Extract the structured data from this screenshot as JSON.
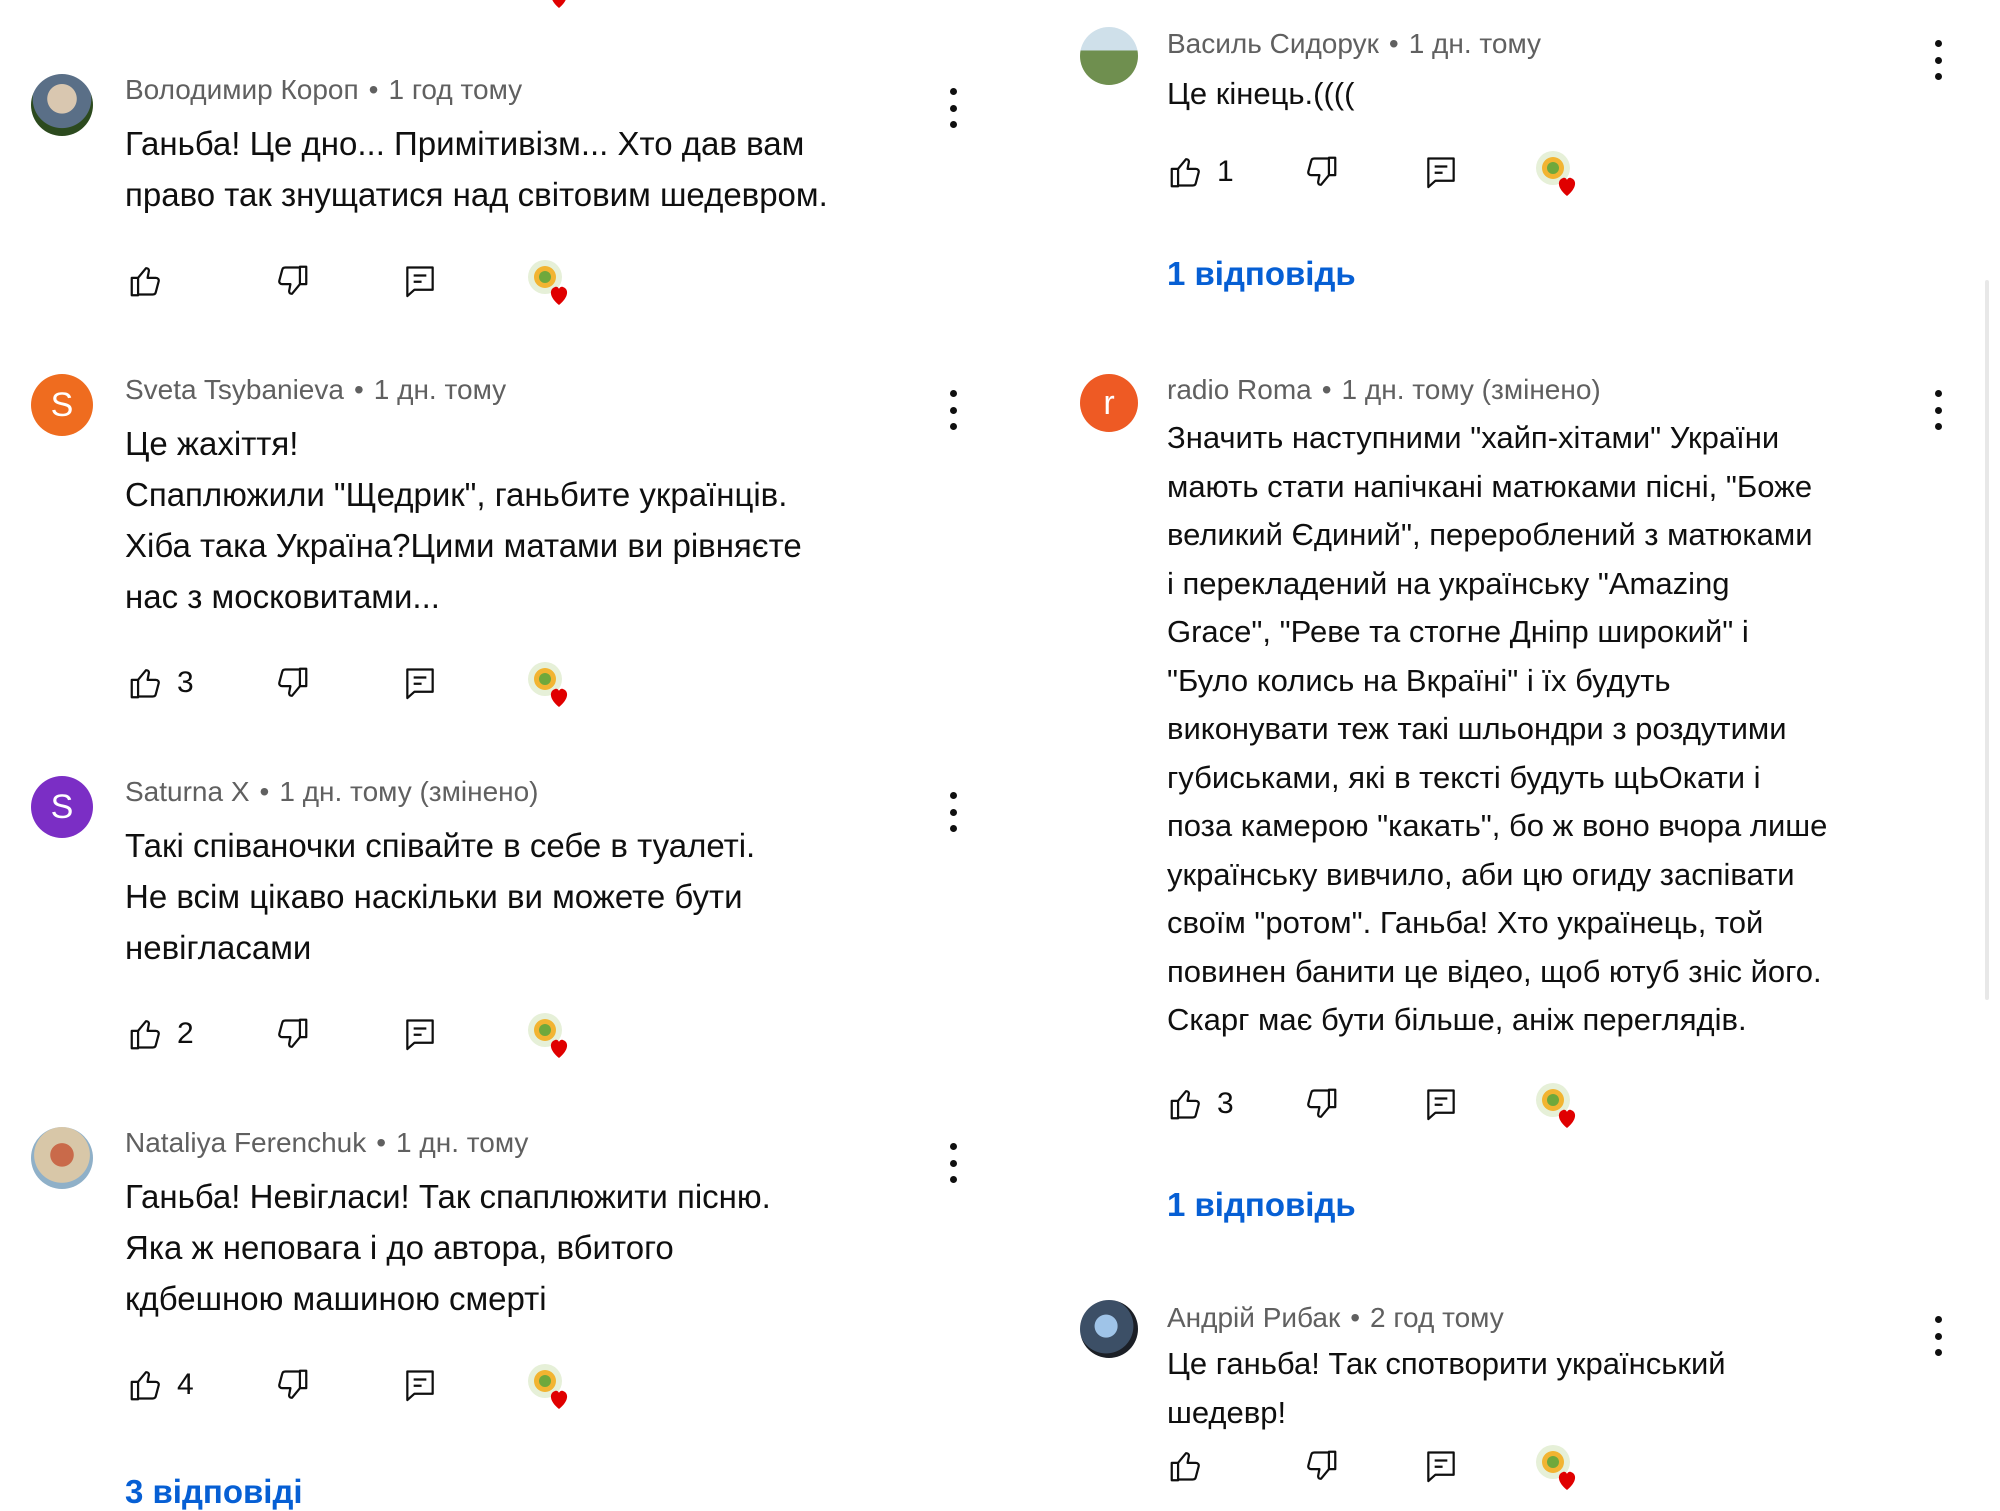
{
  "left_column": {
    "comments": [
      {
        "author": "Володимир Короп",
        "time": "1 год тому",
        "lines": [
          "Ганьба!  Це дно... Примітивізм... Хто дав вам",
          "право так знущатися над світовим шедевром."
        ],
        "likes": "",
        "replies": ""
      },
      {
        "author": "Sveta Tsybanieva",
        "avatar_letter": "S",
        "time": "1 дн. тому",
        "lines": [
          "Це жахіття!",
          "Спаплюжили \"Щедрик\", ганьбите українців.",
          "Хіба така Україна?Цими матами ви рівняєте",
          "нас з московитами..."
        ],
        "likes": "3",
        "replies": ""
      },
      {
        "author": "Saturna X",
        "avatar_letter": "S",
        "time": "1 дн. тому (змінено)",
        "lines": [
          "Такі співаночки співайте в себе в туалеті.",
          "Не всім цікаво наскільки ви можете бути",
          "невігласами"
        ],
        "likes": "2",
        "replies": ""
      },
      {
        "author": "Nataliya Ferenchuk",
        "time": "1 дн. тому",
        "lines": [
          "Ганьба! Невігласи! Так спаплюжити пісню.",
          "Яка ж неповага і до автора, вбитого",
          "кдбешною машиною смерті"
        ],
        "likes": "4",
        "replies": "3 відповіді"
      }
    ]
  },
  "right_column": {
    "comments": [
      {
        "author": "Василь Сидорук",
        "time": "1 дн. тому",
        "lines": [
          "Це кінець.(((("
        ],
        "likes": "1",
        "replies": "1 відповідь"
      },
      {
        "author": "radio Roma",
        "avatar_letter": "r",
        "time": "1 дн. тому (змінено)",
        "lines": [
          "Значить наступними \"хайп-хітами\" України",
          "мають стати напічкані матюками пісні, \"Боже",
          "великий Єдиний\", перероблений з матюками",
          "і перекладений на українську \"Amazing",
          "Grace\", \"Реве та стогне Дніпр широкий\" і",
          "\"Було колись на Вкраїні\" і їх будуть",
          "виконувати теж такі шльондри з роздутими",
          "губиськами, які  в тексті будуть щЬОкати і",
          "поза камерою \"какать\", бо ж воно вчора лише",
          "українську вивчило, аби цю огиду заспівати",
          "своїм \"ротом\". Ганьба! Хто українець, той",
          "повинен банити це відео, щоб ютуб зніс його.",
          "Скарг має бути більше, аніж переглядів."
        ],
        "likes": "3",
        "replies": "1 відповідь"
      },
      {
        "author": "Андрій Рибак",
        "time": "2 год тому",
        "lines": [
          "Це ганьба! Так спотворити український",
          "шедевр!"
        ],
        "likes": "",
        "replies": ""
      }
    ]
  },
  "separator": "•",
  "colors": {
    "link": "#065fd4",
    "meta": "#606060",
    "heart": "#e00000"
  }
}
